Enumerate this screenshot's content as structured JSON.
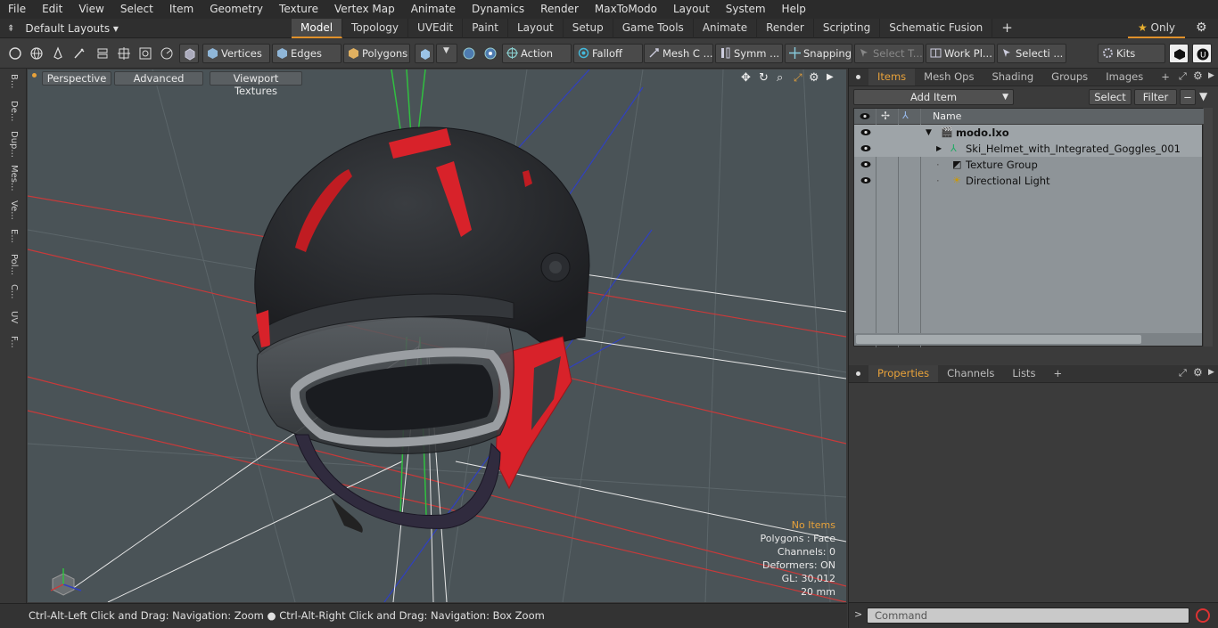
{
  "menu": [
    "File",
    "Edit",
    "View",
    "Select",
    "Item",
    "Geometry",
    "Texture",
    "Vertex Map",
    "Animate",
    "Dynamics",
    "Render",
    "MaxToModo",
    "Layout",
    "System",
    "Help"
  ],
  "layouts_label": "Default Layouts ▾",
  "tabs": [
    "Model",
    "Topology",
    "UVEdit",
    "Paint",
    "Layout",
    "Setup",
    "Game Tools",
    "Animate",
    "Render",
    "Scripting",
    "Schematic Fusion"
  ],
  "tab_plus": "+",
  "only_label": "Only",
  "toolbar": {
    "vertices": "Vertices",
    "edges": "Edges",
    "polygons": "Polygons",
    "action": "Action",
    "falloff": "Falloff",
    "mesh": "Mesh C ...",
    "symm": "Symm ...",
    "snapping": "Snapping",
    "select_t": "Select T...",
    "work_pl": "Work Pl...",
    "selecti": "Selecti ...",
    "kits": "Kits"
  },
  "left_strip": [
    "B...",
    "De...",
    "Dup...",
    "Mes...",
    "Ve...",
    "E...",
    "Pol...",
    "C...",
    "UV",
    "F..."
  ],
  "viewport": {
    "perspective": "Perspective",
    "advanced": "Advanced",
    "viewport_textures": "Viewport Textures"
  },
  "info": {
    "no_items": "No Items",
    "polygons": "Polygons : Face",
    "channels": "Channels: 0",
    "deformers": "Deformers: ON",
    "gl": "GL: 30,012",
    "scale": "20 mm"
  },
  "status": "Ctrl-Alt-Left Click and Drag: Navigation: Zoom ● Ctrl-Alt-Right Click and Drag: Navigation: Box Zoom",
  "panel_tabs": [
    "Items",
    "Mesh Ops",
    "Shading",
    "Groups",
    "Images"
  ],
  "panel_plus": "+",
  "add_item": "Add Item",
  "select_btn": "Select",
  "filter_btn": "Filter",
  "tree_header": "Name",
  "tree": [
    "modo.lxo",
    "Ski_Helmet_with_Integrated_Goggles_001",
    "Texture Group",
    "Directional Light"
  ],
  "props_tabs": [
    "Properties",
    "Channels",
    "Lists"
  ],
  "command_placeholder": "Command",
  "colors": {
    "accent": "#e8a23a",
    "helmet_red": "#d8222a",
    "helmet_black": "#2a2c2f",
    "viewport_bg": "#4b5458"
  }
}
